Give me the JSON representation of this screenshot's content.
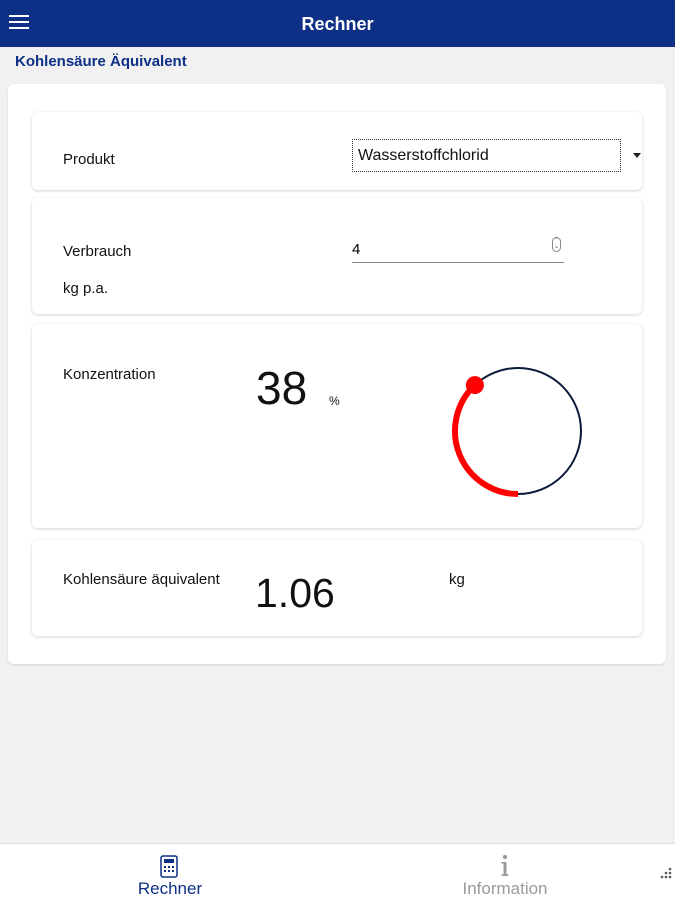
{
  "header": {
    "title": "Rechner",
    "menu_icon": "hamburger-menu-icon"
  },
  "page": {
    "title": "Kohlensäure Äquivalent"
  },
  "produkt": {
    "label": "Produkt",
    "selected": "Wasserstoffchlorid"
  },
  "verbrauch": {
    "label": "Verbrauch",
    "unit": "kg p.a.",
    "value": "4"
  },
  "konzentration": {
    "label": "Konzentration",
    "value": "38",
    "unit": "%",
    "fraction": 0.38
  },
  "result": {
    "label": "Kohlensäure äquivalent",
    "value": "1.06",
    "unit": "kg"
  },
  "tabs": [
    {
      "label": "Rechner",
      "icon": "calculator-icon",
      "active": true
    },
    {
      "label": "Information",
      "icon": "info-icon",
      "active": false
    }
  ],
  "colors": {
    "primary": "#0d2f86",
    "gauge_active": "#ff0000",
    "gauge_track": "#0a1a3a",
    "tab_inactive": "#9a9a9a"
  }
}
